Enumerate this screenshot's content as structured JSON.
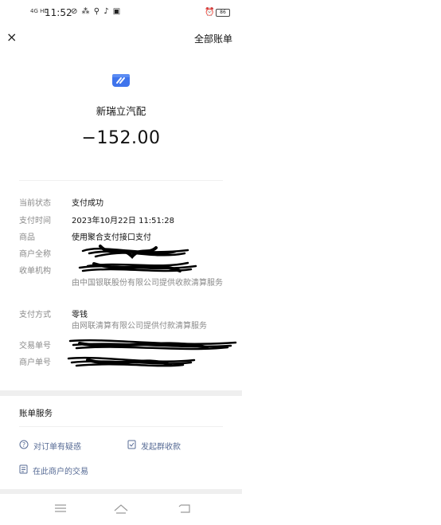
{
  "status_bar": {
    "signal": "4G HD",
    "time": "11:52",
    "icons": "⊘ ⁂ ⚲ ♪ ▣",
    "battery": "86"
  },
  "header": {
    "close_icon": "×",
    "all_bills_label": "全部账单"
  },
  "merchant": {
    "icon": "merchant-logo-icon",
    "name": "新瑞立汽配",
    "amount": "−152.00"
  },
  "details": {
    "status_label": "当前状态",
    "status_value": "支付成功",
    "time_label": "支付时间",
    "time_value": "2023年10月22日 11:51:28",
    "product_label": "商品",
    "product_value": "使用聚合支付接口支付",
    "merchant_full_label": "商户全称",
    "merchant_full_value": "",
    "acquirer_label": "收单机构",
    "acquirer_value": "",
    "acquirer_note": "由中国银联股份有限公司提供收款清算服务",
    "method_label": "支付方式",
    "method_value": "零钱",
    "method_note": "由网联清算有限公司提供付款清算服务",
    "trade_no_label": "交易单号",
    "trade_no_value": "",
    "merchant_no_label": "商户单号",
    "merchant_no_value": ""
  },
  "services": {
    "title": "账单服务",
    "question_order": "对订单有疑惑",
    "group_collect": "发起群收款",
    "merchant_trades": "在此商户的交易"
  },
  "colors": {
    "link": "#576b95",
    "logo": "#3f74ec"
  }
}
